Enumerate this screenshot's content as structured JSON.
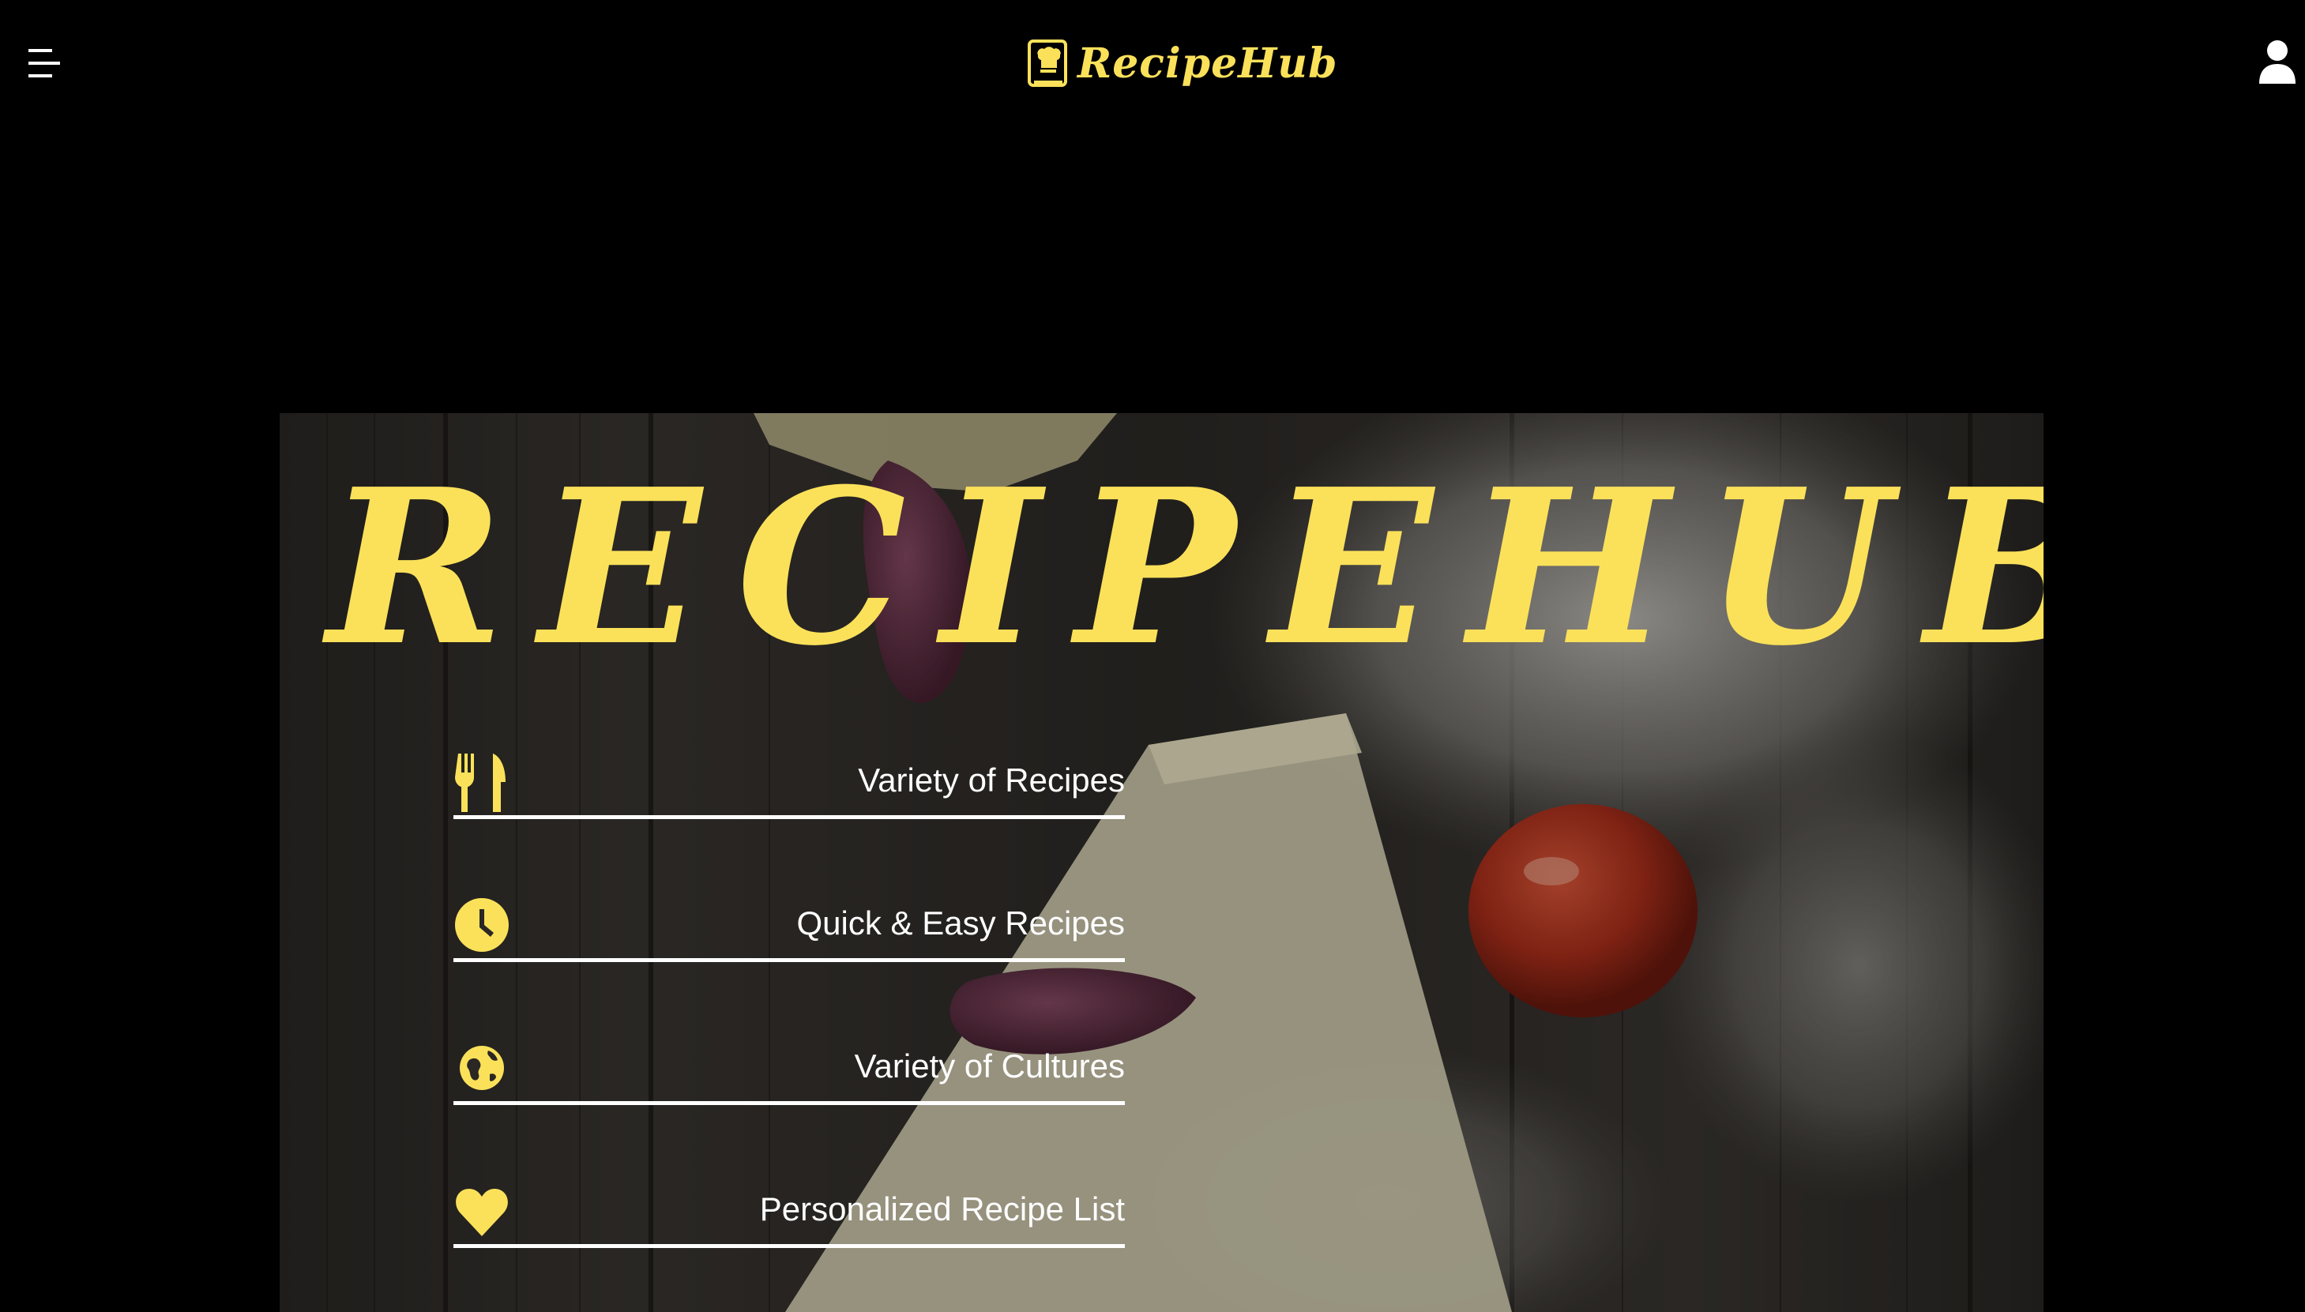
{
  "nav": {
    "menu_icon": "hamburger-menu-icon",
    "brand_name": "RecipeHub",
    "logo_icon": "chef-book-icon",
    "user_icon": "user-profile-icon"
  },
  "hero": {
    "title": "RECIPEHUB",
    "background": "cheese-garlic-tomato-on-wood-photo",
    "features": [
      {
        "label": "Variety of Recipes",
        "icon": "fork-knife-icon"
      },
      {
        "label": "Quick & Easy Recipes",
        "icon": "clock-icon"
      },
      {
        "label": "Variety of Cultures",
        "icon": "globe-icon"
      },
      {
        "label": "Personalized Recipe List",
        "icon": "heart-icon"
      }
    ]
  },
  "colors": {
    "accent": "#fbe15a",
    "background": "#000000",
    "text": "#ffffff"
  }
}
